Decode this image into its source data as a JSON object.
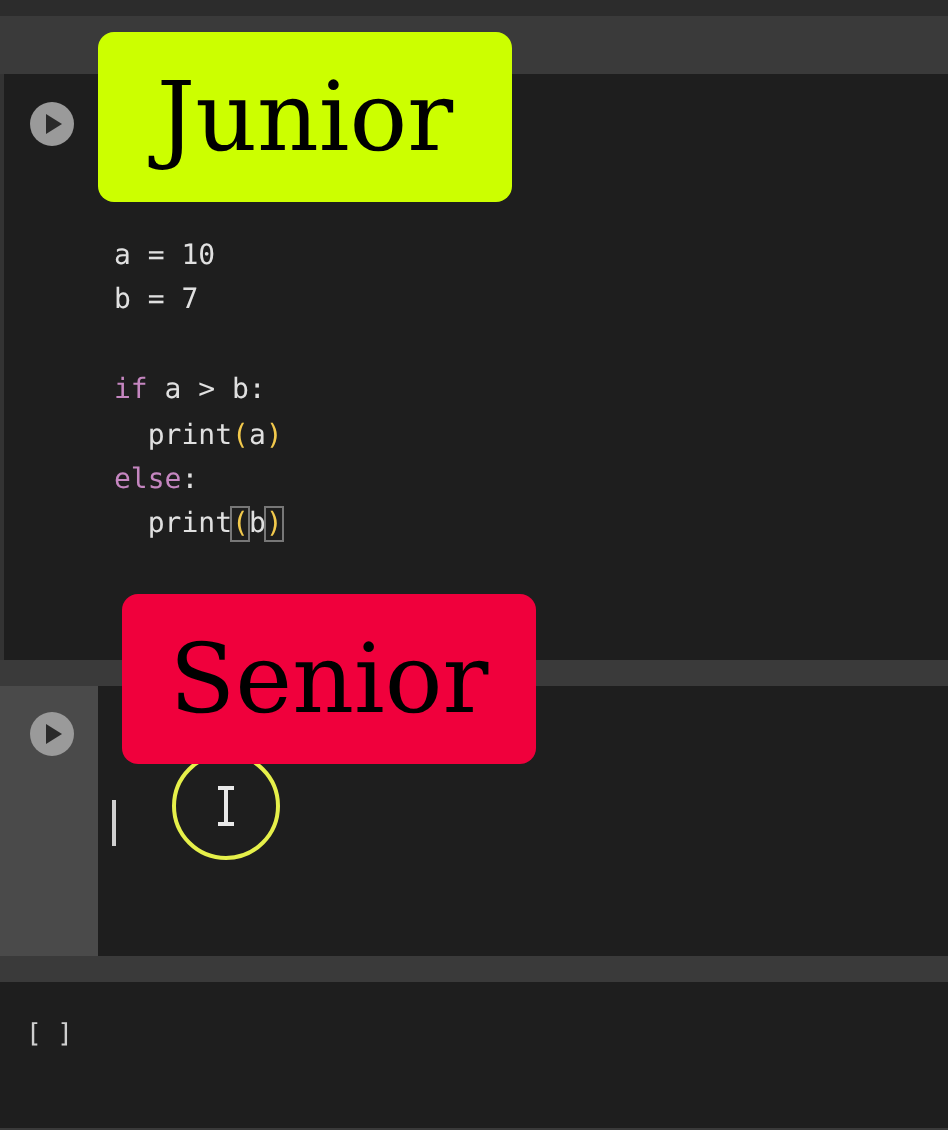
{
  "cells": [
    {
      "kind": "code",
      "selected": false,
      "lines": [
        {
          "kind": "code",
          "tokens": [
            {
              "t": "a = 10",
              "kind": "plain"
            }
          ]
        },
        {
          "kind": "code",
          "tokens": [
            {
              "t": "b = 7",
              "kind": "plain"
            }
          ]
        },
        {
          "kind": "blank"
        },
        {
          "kind": "code",
          "tokens": [
            {
              "t": "if",
              "kind": "keyword"
            },
            {
              "t": " a > b:",
              "kind": "plain"
            }
          ]
        },
        {
          "kind": "code",
          "tokens": [
            {
              "t": "  print",
              "kind": "plain"
            },
            {
              "t": "(",
              "kind": "paren"
            },
            {
              "t": "a",
              "kind": "plain"
            },
            {
              "t": ")",
              "kind": "paren"
            }
          ]
        },
        {
          "kind": "code",
          "tokens": [
            {
              "t": "else",
              "kind": "keyword"
            },
            {
              "t": ":",
              "kind": "plain"
            }
          ]
        },
        {
          "kind": "code",
          "tokens": [
            {
              "t": "  print",
              "kind": "plain"
            },
            {
              "t": "(",
              "kind": "paren",
              "matched": true
            },
            {
              "t": "b",
              "kind": "plain"
            },
            {
              "t": ")",
              "kind": "paren",
              "matched": true
            }
          ]
        }
      ]
    },
    {
      "kind": "empty",
      "selected": true
    },
    {
      "kind": "output",
      "prompt": "[ ]"
    }
  ],
  "labels": [
    {
      "text": "Junior",
      "color": "#ccff00"
    },
    {
      "text": "Senior",
      "color": "#f0003c"
    }
  ]
}
